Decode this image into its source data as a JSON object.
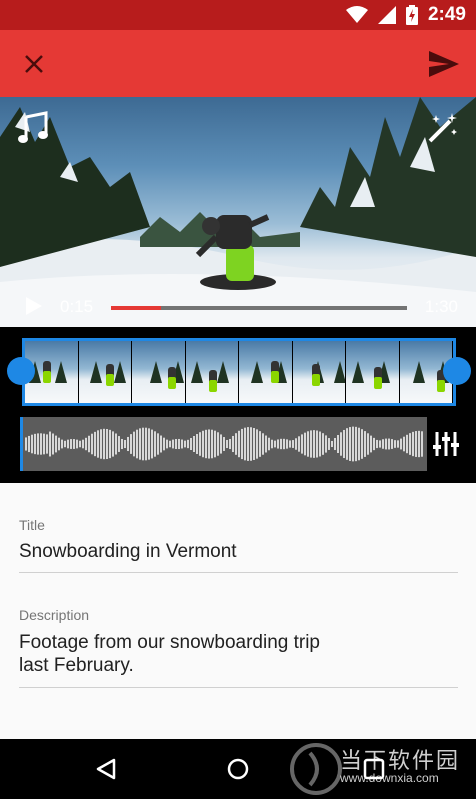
{
  "status_bar": {
    "time": "2:49",
    "icons": [
      "wifi-icon",
      "signal-icon",
      "battery-charging-icon"
    ]
  },
  "app_bar": {
    "close_icon": "close-icon",
    "send_icon": "send-icon",
    "color": "#e53935"
  },
  "player": {
    "current_time": "0:15",
    "total_time": "1:30",
    "progress": 0.17,
    "music_icon": "music-note-icon",
    "enhance_icon": "magic-wand-icon",
    "play_icon": "play-icon"
  },
  "editor": {
    "filmstrip_frames": 8,
    "accent": "#1e88e5",
    "mixer_icon": "audio-mixer-icon"
  },
  "form": {
    "title_label": "Title",
    "title_value": "Snowboarding in Vermont",
    "description_label": "Description",
    "description_line1": "Footage from our snowboarding trip",
    "description_line2": "last February."
  },
  "nav_bar": {
    "back_icon": "back-icon",
    "home_icon": "home-icon",
    "recents_icon": "recents-icon"
  },
  "watermark": {
    "text": "当下软件园",
    "url": "www.downxia.com"
  }
}
